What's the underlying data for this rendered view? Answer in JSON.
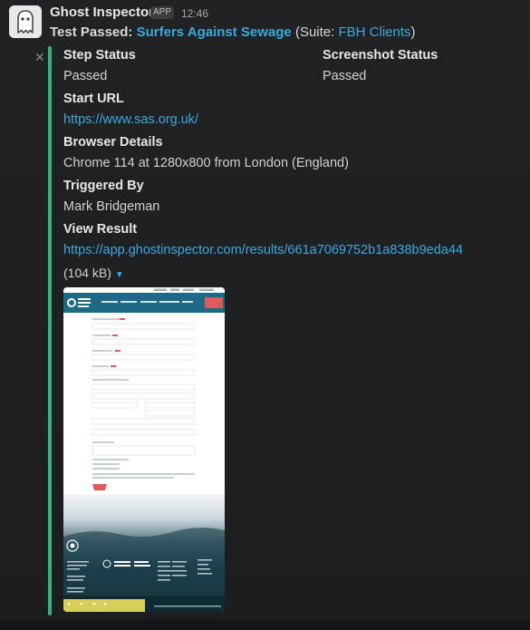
{
  "header": {
    "app_name": "Ghost Inspector",
    "badge": "APP",
    "time": "12:46"
  },
  "message": {
    "prefix": "Test Passed:",
    "test_name": "Surfers Against Sewage",
    "suite_open": "(Suite:",
    "suite_name": "FBH Clients",
    "suite_close": ")"
  },
  "fields": {
    "step_status_title": "Step Status",
    "step_status_value": "Passed",
    "screenshot_status_title": "Screenshot Status",
    "screenshot_status_value": "Passed",
    "start_url_title": "Start URL",
    "start_url_value": "https://www.sas.org.uk/",
    "browser_title": "Browser Details",
    "browser_value": "Chrome 114 at 1280x800 from London (England)",
    "triggered_title": "Triggered By",
    "triggered_value": "Mark Bridgeman",
    "view_result_title": "View Result",
    "view_result_value": "https://app.ghostinspector.com/results/661a7069752b1a838b9eda44"
  },
  "attachment": {
    "size": "(104 kB)",
    "thumbnail": {
      "brand_text": "SURFERS AGAINST SEWAGE",
      "cta_label": "Donate"
    }
  },
  "icons": {
    "avatar": "ghost-icon",
    "close": "close-icon",
    "caret": "caret-down-icon"
  },
  "colors": {
    "link": "#3ba9e0",
    "accent": "#2eb67d",
    "background": "#1f2022"
  }
}
